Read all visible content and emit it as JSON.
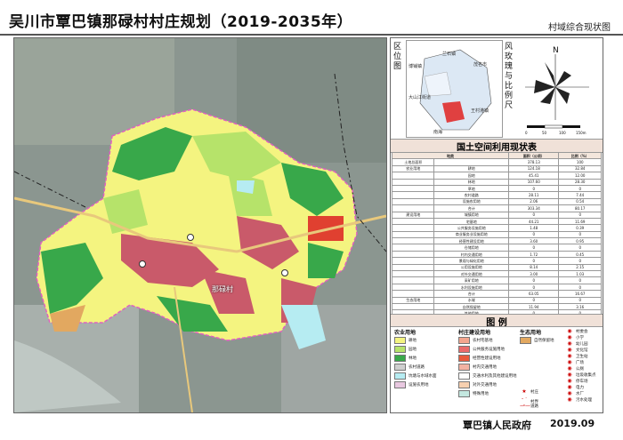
{
  "title": "吴川市覃巴镇那碌村村庄规划（2019-2035年）",
  "subtitle": "村域综合现状图",
  "location": {
    "label": "区位图",
    "places": [
      "兰石镇",
      "博铺镇",
      "茂名市",
      "大山江街道",
      "王村港镇",
      "浅水镇",
      "南海"
    ]
  },
  "wind_rose": {
    "label": "风玫瑰与比例尺",
    "north": "N",
    "scale": [
      "0",
      "50",
      "100",
      "150m"
    ]
  },
  "map": {
    "village_name": "那碌村"
  },
  "table": {
    "title": "国土空间利用现状表",
    "header": [
      "地类",
      "面积（公顷）",
      "比例（%）"
    ],
    "rows": [
      [
        "土地总面积",
        "",
        "378.13",
        "100"
      ],
      [
        "农业用地",
        "耕地",
        "124.18",
        "32.84"
      ],
      [
        "",
        "园地",
        "45.41",
        "12.00"
      ],
      [
        "",
        "林地",
        "107.60",
        "28.30"
      ],
      [
        "",
        "草地",
        "0",
        "0"
      ],
      [
        "",
        "农村道路",
        "28.11",
        "7.44"
      ],
      [
        "",
        "设施农用地",
        "2.06",
        "0.54"
      ],
      [
        "",
        "合计",
        "303.34",
        "80.17"
      ],
      [
        "建设用地",
        "城镇用地",
        "0",
        "0"
      ],
      [
        "",
        "宅基地",
        "44.21",
        "11.69"
      ],
      [
        "",
        "公共服务设施用地",
        "1.48",
        "0.39"
      ],
      [
        "",
        "商业服务业设施用地",
        "0",
        "0"
      ],
      [
        "",
        "经营性建设用地",
        "3.60",
        "0.95"
      ],
      [
        "",
        "仓储用地",
        "0",
        "0"
      ],
      [
        "",
        "村内交通用地",
        "1.72",
        "0.45"
      ],
      [
        "",
        "景观与绿化用地",
        "0",
        "0"
      ],
      [
        "",
        "公用设施用地",
        "8.14",
        "2.15"
      ],
      [
        "",
        "对外交通用地",
        "3.00",
        "1.03"
      ],
      [
        "",
        "采矿用地",
        "0",
        "0"
      ],
      [
        "",
        "水利设施用地",
        "0",
        "0"
      ],
      [
        "",
        "合计",
        "63.05",
        "16.67"
      ],
      [
        "生态用地",
        "水域",
        "0",
        "0"
      ],
      [
        "",
        "自然保留地",
        "11.94",
        "3.16"
      ],
      [
        "",
        "其他用地",
        "0",
        "0"
      ],
      [
        "",
        "合计",
        "11.94",
        "3.16"
      ]
    ]
  },
  "legend": {
    "title": "图 例",
    "groups": [
      {
        "name": "农业用地",
        "items": [
          {
            "label": "耕地",
            "color": "#f4f480"
          },
          {
            "label": "园地",
            "color": "#b6e36a"
          },
          {
            "label": "林地",
            "color": "#38a84a"
          },
          {
            "label": "农村道路",
            "color": "#cfcfcf"
          },
          {
            "label": "坑塘与水域水面",
            "color": "#b6ecf2"
          },
          {
            "label": "设施农用地",
            "color": "#e8c8e0"
          }
        ]
      },
      {
        "name": "村庄建设用地",
        "items": [
          {
            "label": "农村宅基地",
            "color": "#f3a58e"
          },
          {
            "label": "公共服务设施用地",
            "color": "#ea6a6a"
          },
          {
            "label": "经营性建设用地",
            "color": "#e85a3c"
          },
          {
            "label": "村内交通用地",
            "color": "#f2b2a2"
          },
          {
            "label": "交通水利及其他建设用地",
            "color": "#fff"
          },
          {
            "label": "对外交通用地",
            "color": "#f7d0b0"
          },
          {
            "label": "特殊用地",
            "color": "#c4e8e0"
          }
        ]
      },
      {
        "name": "生态用地",
        "items": [
          {
            "label": "自然保留地",
            "color": "#e2a860"
          }
        ]
      },
      {
        "name": "",
        "items": [
          {
            "label": "村委会"
          },
          {
            "label": "小学"
          },
          {
            "label": "幼儿园"
          },
          {
            "label": "文化馆"
          },
          {
            "label": "卫生站"
          },
          {
            "label": "广场"
          },
          {
            "label": "公厕"
          },
          {
            "label": "垃圾收集点"
          },
          {
            "label": "停车场"
          },
          {
            "label": "电力"
          },
          {
            "label": "水厂"
          },
          {
            "label": "污水处理"
          }
        ]
      }
    ],
    "symbols": {
      "village": "村庄",
      "boundary": "村界",
      "road": "道路"
    }
  },
  "footer": {
    "org": "覃巴镇人民政府",
    "date": "2019.09"
  }
}
